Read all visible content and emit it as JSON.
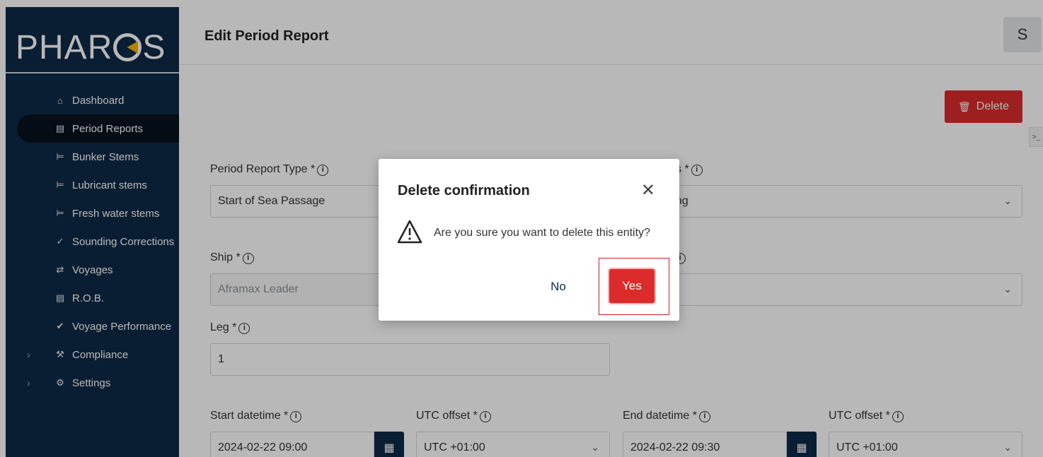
{
  "app": {
    "logo_text": "PHAR",
    "logo_text_end": "S"
  },
  "sidebar": {
    "items": [
      {
        "label": "Dashboard",
        "icon": "home-icon"
      },
      {
        "label": "Period Reports",
        "icon": "document-icon",
        "active": true
      },
      {
        "label": "Bunker Stems",
        "icon": "sitemap-icon"
      },
      {
        "label": "Lubricant stems",
        "icon": "sitemap-icon"
      },
      {
        "label": "Fresh water stems",
        "icon": "sitemap-icon"
      },
      {
        "label": "Sounding Corrections",
        "icon": "double-check-icon"
      },
      {
        "label": "Voyages",
        "icon": "swap-arrows-icon"
      },
      {
        "label": "R.O.B.",
        "icon": "gauge-icon"
      },
      {
        "label": "Voyage Performance",
        "icon": "check-circle-icon"
      },
      {
        "label": "Compliance",
        "icon": "hammer-icon",
        "expandable": true
      },
      {
        "label": "Settings",
        "icon": "gears-icon",
        "expandable": true
      }
    ]
  },
  "header": {
    "title": "Edit Period Report",
    "avatar_initial": "S"
  },
  "toolbar": {
    "delete_label": "Delete"
  },
  "form": {
    "period_report_type": {
      "label": "Period Report Type *",
      "value": "Start of Sea Passage"
    },
    "status": {
      "label": "s *",
      "value": "ring"
    },
    "ship": {
      "label": "Ship *",
      "value": "Aframax Leader"
    },
    "voyage": {
      "label": ""
    },
    "leg": {
      "label": "Leg *",
      "value": "1"
    },
    "start_datetime": {
      "label": "Start datetime *",
      "value": "2024-02-22 09:00"
    },
    "start_utc_offset": {
      "label": "UTC offset *",
      "value": "UTC +01:00"
    },
    "end_datetime": {
      "label": "End datetime *",
      "value": "2024-02-22 09:30"
    },
    "end_utc_offset": {
      "label": "UTC offset *",
      "value": "UTC +01:00"
    }
  },
  "modal": {
    "title": "Delete confirmation",
    "message": "Are you sure you want to delete this entity?",
    "no_label": "No",
    "yes_label": "Yes"
  },
  "colors": {
    "sidebar": "#0f2a47",
    "danger": "#dc2b2b",
    "accent_logo": "#f2b705"
  }
}
